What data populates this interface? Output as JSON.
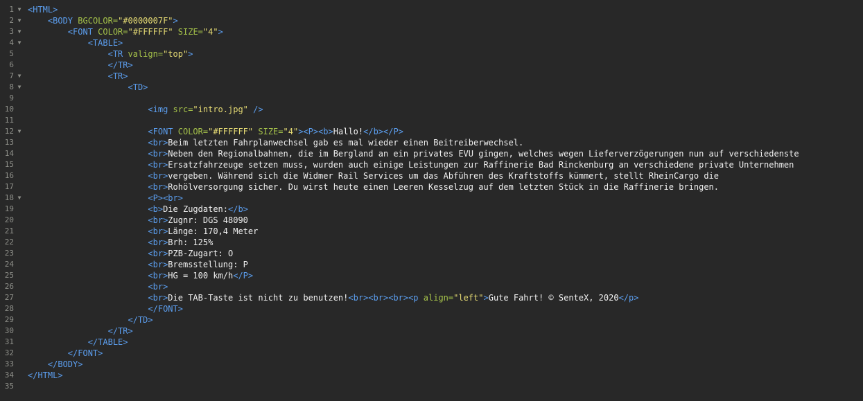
{
  "editor": {
    "lines": [
      {
        "n": "1",
        "fold": "▼",
        "indent": "",
        "tokens": [
          {
            "t": "tag",
            "v": "<HTML>"
          }
        ]
      },
      {
        "n": "2",
        "fold": "▼",
        "indent": "    ",
        "tokens": [
          {
            "t": "tag",
            "v": "<BODY "
          },
          {
            "t": "attr",
            "v": "BGCOLOR="
          },
          {
            "t": "str",
            "v": "\"#0000007F\""
          },
          {
            "t": "tag",
            "v": ">"
          }
        ]
      },
      {
        "n": "3",
        "fold": "▼",
        "indent": "        ",
        "tokens": [
          {
            "t": "tag",
            "v": "<FONT "
          },
          {
            "t": "attr",
            "v": "COLOR="
          },
          {
            "t": "str",
            "v": "\"#FFFFFF\""
          },
          {
            "t": "txt",
            "v": " "
          },
          {
            "t": "attr",
            "v": "SIZE="
          },
          {
            "t": "str",
            "v": "\"4\""
          },
          {
            "t": "tag",
            "v": ">"
          }
        ]
      },
      {
        "n": "4",
        "fold": "▼",
        "indent": "            ",
        "tokens": [
          {
            "t": "tag",
            "v": "<TABLE>"
          }
        ]
      },
      {
        "n": "5",
        "fold": "",
        "indent": "                ",
        "tokens": [
          {
            "t": "tag",
            "v": "<TR "
          },
          {
            "t": "attr",
            "v": "valign="
          },
          {
            "t": "str",
            "v": "\"top\""
          },
          {
            "t": "tag",
            "v": ">"
          }
        ]
      },
      {
        "n": "6",
        "fold": "",
        "indent": "                ",
        "tokens": [
          {
            "t": "tag",
            "v": "</TR>"
          }
        ]
      },
      {
        "n": "7",
        "fold": "▼",
        "indent": "                ",
        "tokens": [
          {
            "t": "tag",
            "v": "<TR>"
          }
        ]
      },
      {
        "n": "8",
        "fold": "▼",
        "indent": "                    ",
        "tokens": [
          {
            "t": "tag",
            "v": "<TD>"
          }
        ]
      },
      {
        "n": "9",
        "fold": "",
        "indent": "",
        "tokens": []
      },
      {
        "n": "10",
        "fold": "",
        "indent": "                        ",
        "tokens": [
          {
            "t": "tag",
            "v": "<img "
          },
          {
            "t": "attr",
            "v": "src="
          },
          {
            "t": "str",
            "v": "\"intro.jpg\""
          },
          {
            "t": "txt",
            "v": " "
          },
          {
            "t": "tag",
            "v": "/>"
          }
        ]
      },
      {
        "n": "11",
        "fold": "",
        "indent": "",
        "tokens": []
      },
      {
        "n": "12",
        "fold": "▼",
        "indent": "                        ",
        "tokens": [
          {
            "t": "tag",
            "v": "<FONT "
          },
          {
            "t": "attr",
            "v": "COLOR="
          },
          {
            "t": "str",
            "v": "\"#FFFFFF\""
          },
          {
            "t": "txt",
            "v": " "
          },
          {
            "t": "attr",
            "v": "SIZE="
          },
          {
            "t": "str",
            "v": "\"4\""
          },
          {
            "t": "tag",
            "v": "><P><b>"
          },
          {
            "t": "txt",
            "v": "Hallo!"
          },
          {
            "t": "tag",
            "v": "</b></P>"
          }
        ]
      },
      {
        "n": "13",
        "fold": "",
        "indent": "                        ",
        "tokens": [
          {
            "t": "tag",
            "v": "<br>"
          },
          {
            "t": "txt",
            "v": "Beim letzten Fahrplanwechsel gab es mal wieder einen Beitreiberwechsel."
          }
        ]
      },
      {
        "n": "14",
        "fold": "",
        "indent": "                        ",
        "tokens": [
          {
            "t": "tag",
            "v": "<br>"
          },
          {
            "t": "txt",
            "v": "Neben den Regionalbahnen, die im Bergland an ein privates EVU gingen, welches wegen Lieferverzögerungen nun auf verschiedenste"
          }
        ]
      },
      {
        "n": "15",
        "fold": "",
        "indent": "                        ",
        "tokens": [
          {
            "t": "tag",
            "v": "<br>"
          },
          {
            "t": "txt",
            "v": "Ersatzfahrzeuge setzen muss, wurden auch einige Leistungen zur Raffinerie Bad Rinckenburg an verschiedene private Unternehmen"
          }
        ]
      },
      {
        "n": "16",
        "fold": "",
        "indent": "                        ",
        "tokens": [
          {
            "t": "tag",
            "v": "<br>"
          },
          {
            "t": "txt",
            "v": "vergeben. Während sich die Widmer Rail Services um das Abführen des Kraftstoffs kümmert, stellt RheinCargo die"
          }
        ]
      },
      {
        "n": "17",
        "fold": "",
        "indent": "                        ",
        "tokens": [
          {
            "t": "tag",
            "v": "<br>"
          },
          {
            "t": "txt",
            "v": "Rohölversorgung sicher. Du wirst heute einen Leeren Kesselzug auf dem letzten Stück in die Raffinerie bringen."
          }
        ]
      },
      {
        "n": "18",
        "fold": "▼",
        "indent": "                        ",
        "tokens": [
          {
            "t": "tag",
            "v": "<P><br>"
          }
        ]
      },
      {
        "n": "19",
        "fold": "",
        "indent": "                        ",
        "tokens": [
          {
            "t": "tag",
            "v": "<b>"
          },
          {
            "t": "txt",
            "v": "Die Zugdaten:"
          },
          {
            "t": "tag",
            "v": "</b>"
          }
        ]
      },
      {
        "n": "20",
        "fold": "",
        "indent": "                        ",
        "tokens": [
          {
            "t": "tag",
            "v": "<br>"
          },
          {
            "t": "txt",
            "v": "Zugnr: DGS 48090"
          }
        ]
      },
      {
        "n": "21",
        "fold": "",
        "indent": "                        ",
        "tokens": [
          {
            "t": "tag",
            "v": "<br>"
          },
          {
            "t": "txt",
            "v": "Länge: 170,4 Meter"
          }
        ]
      },
      {
        "n": "22",
        "fold": "",
        "indent": "                        ",
        "tokens": [
          {
            "t": "tag",
            "v": "<br>"
          },
          {
            "t": "txt",
            "v": "Brh: 125%"
          }
        ]
      },
      {
        "n": "23",
        "fold": "",
        "indent": "                        ",
        "tokens": [
          {
            "t": "tag",
            "v": "<br>"
          },
          {
            "t": "txt",
            "v": "PZB-Zugart: O"
          }
        ]
      },
      {
        "n": "24",
        "fold": "",
        "indent": "                        ",
        "tokens": [
          {
            "t": "tag",
            "v": "<br>"
          },
          {
            "t": "txt",
            "v": "Bremsstellung: P"
          }
        ]
      },
      {
        "n": "25",
        "fold": "",
        "indent": "                        ",
        "tokens": [
          {
            "t": "tag",
            "v": "<br>"
          },
          {
            "t": "txt",
            "v": "HG = 100 km/h"
          },
          {
            "t": "tag",
            "v": "</P>"
          }
        ]
      },
      {
        "n": "26",
        "fold": "",
        "indent": "                        ",
        "tokens": [
          {
            "t": "tag",
            "v": "<br>"
          }
        ]
      },
      {
        "n": "27",
        "fold": "",
        "indent": "                        ",
        "tokens": [
          {
            "t": "tag",
            "v": "<br>"
          },
          {
            "t": "txt",
            "v": "Die TAB-Taste ist nicht zu benutzen!"
          },
          {
            "t": "tag",
            "v": "<br><br><br><p "
          },
          {
            "t": "attr",
            "v": "align="
          },
          {
            "t": "str",
            "v": "\"left\""
          },
          {
            "t": "tag",
            "v": ">"
          },
          {
            "t": "txt",
            "v": "Gute Fahrt! © SenteX, 2020"
          },
          {
            "t": "tag",
            "v": "</p>"
          }
        ]
      },
      {
        "n": "28",
        "fold": "",
        "indent": "                        ",
        "tokens": [
          {
            "t": "tag",
            "v": "</FONT>"
          }
        ]
      },
      {
        "n": "29",
        "fold": "",
        "indent": "                    ",
        "tokens": [
          {
            "t": "tag",
            "v": "</TD>"
          }
        ]
      },
      {
        "n": "30",
        "fold": "",
        "indent": "                ",
        "tokens": [
          {
            "t": "tag",
            "v": "</TR>"
          }
        ]
      },
      {
        "n": "31",
        "fold": "",
        "indent": "            ",
        "tokens": [
          {
            "t": "tag",
            "v": "</TABLE>"
          }
        ]
      },
      {
        "n": "32",
        "fold": "",
        "indent": "        ",
        "tokens": [
          {
            "t": "tag",
            "v": "</FONT>"
          }
        ]
      },
      {
        "n": "33",
        "fold": "",
        "indent": "    ",
        "tokens": [
          {
            "t": "tag",
            "v": "</BODY>"
          }
        ]
      },
      {
        "n": "34",
        "fold": "",
        "indent": "",
        "tokens": [
          {
            "t": "tag",
            "v": "</HTML>"
          }
        ]
      },
      {
        "n": "35",
        "fold": "",
        "indent": "",
        "tokens": []
      }
    ]
  },
  "colors": {
    "background": "#282828",
    "tag": "#5c9ff0",
    "attribute": "#a6c34a",
    "string": "#e6db74",
    "text": "#f0f0f0",
    "line_number": "#8f908a"
  }
}
